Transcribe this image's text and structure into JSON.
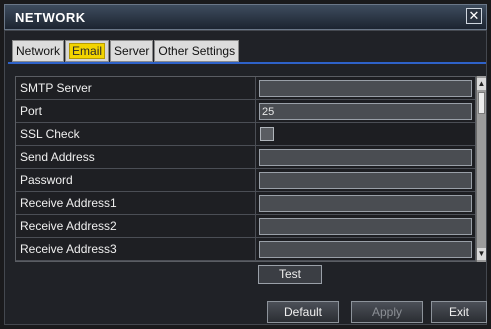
{
  "window": {
    "title": "NETWORK"
  },
  "tabs": [
    {
      "label": "Network"
    },
    {
      "label": "Email"
    },
    {
      "label": "Server"
    },
    {
      "label": "Other Settings"
    }
  ],
  "active_tab": "Email",
  "rows": [
    {
      "label": "SMTP Server",
      "value": ""
    },
    {
      "label": "Port",
      "value": "25"
    },
    {
      "label": "SSL Check",
      "checked": false
    },
    {
      "label": "Send Address",
      "value": ""
    },
    {
      "label": "Password",
      "value": ""
    },
    {
      "label": "Receive Address1",
      "value": ""
    },
    {
      "label": "Receive Address2",
      "value": ""
    },
    {
      "label": "Receive Address3",
      "value": ""
    }
  ],
  "test_button": "Test",
  "footer": {
    "default_label": "Default",
    "apply_label": "Apply",
    "exit_label": "Exit"
  },
  "colors": {
    "active_tab_highlight": "#f2d400",
    "tab_underline": "#2e62c9",
    "title_bar": "#1c2430"
  }
}
